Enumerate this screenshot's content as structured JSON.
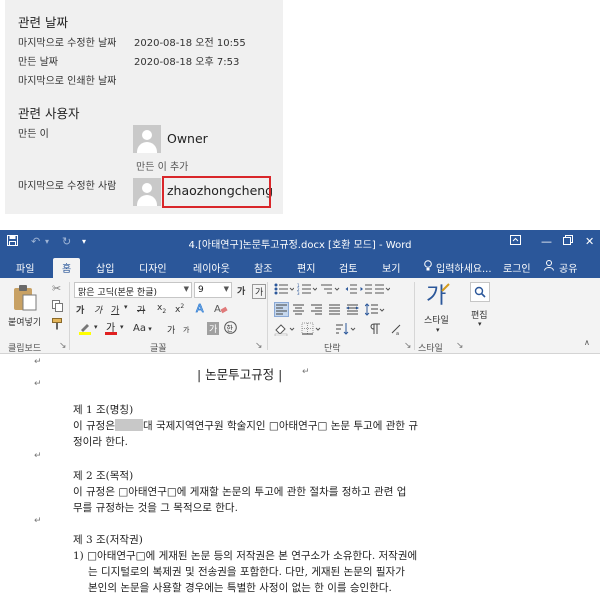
{
  "properties": {
    "related_dates_heading": "관련 날짜",
    "last_modified_label": "마지막으로 수정한 날짜",
    "last_modified_value": "2020-08-18 오전 10:55",
    "created_label": "만든 날짜",
    "created_value": "2020-08-18 오후 7:53",
    "last_printed_label": "마지막으로 인쇄한 날짜",
    "related_people_heading": "관련 사용자",
    "author_label": "만든 이",
    "author_name": "Owner",
    "add_author": "만든 이 추가",
    "last_modified_by_label": "마지막으로 수정한 사람",
    "last_modified_by_name": "zhaozhongcheng"
  },
  "window": {
    "title": "4.[아태연구]논문투고규정.docx [호환 모드] - Word"
  },
  "tabs": [
    {
      "label": "파일"
    },
    {
      "label": "홈"
    },
    {
      "label": "삽입"
    },
    {
      "label": "디자인"
    },
    {
      "label": "레이아웃"
    },
    {
      "label": "참조"
    },
    {
      "label": "편지"
    },
    {
      "label": "검토"
    },
    {
      "label": "보기"
    }
  ],
  "tellme": "입력하세요...",
  "signin": "로그인",
  "share": "공유",
  "ribbon": {
    "paste_label": "붙여넣기",
    "font_name": "맑은 고딕(본문 한글)",
    "font_size": "9",
    "bold": "가",
    "italic": "가",
    "underline": "가",
    "strike": "가",
    "subscript": "x",
    "superscript": "x",
    "grow_font": "가",
    "shrink_font": "가",
    "clear_format": "가",
    "aa": "Aa",
    "phonetic": "가",
    "style_label": "스타일",
    "edit_label": "편집",
    "groups": {
      "clipboard": "클립보드",
      "font": "글꼴",
      "paragraph": "단락",
      "styles": "스타일"
    }
  },
  "document": {
    "heading": "| 논문투고규정 |",
    "a1_title": "제 1 조(명칭)",
    "a1_line1_pre": "이 규정은",
    "a1_line1_post": "대 국제지역연구원 학술지인 □아태연구□ 논문 투고에 관한 규",
    "a1_line2": "정이라 한다.",
    "a2_title": "제 2 조(목적)",
    "a2_line1": "이 규정은 □아태연구□에 게재할 논문의 투고에 관한 절차를 정하고 관련 업",
    "a2_line2": "무를 규정하는 것을 그 목적으로 한다.",
    "a3_title": "제 3 조(저작권)",
    "a3_line1": "1)  □아태연구□에 게재된 논문 등의 저작권은 본 연구소가 소유한다. 저작권에",
    "a3_line2": "는 디지털로의 복제권 및 전송권을 포함한다. 다만, 게재된 논문의 필자가",
    "a3_line3": "본인의 논문을 사용할 경우에는 특별한 사정이 없는 한 이를 승인한다."
  },
  "colors": {
    "word_blue": "#2b579a",
    "highlight_red": "#d9262a"
  }
}
